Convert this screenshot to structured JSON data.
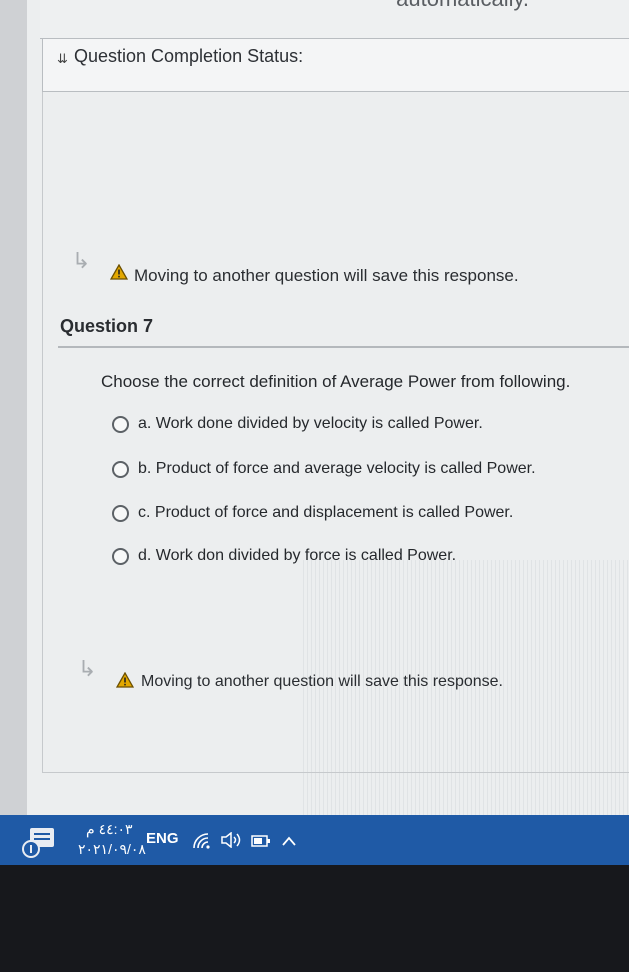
{
  "page": {
    "top_fragment": "automatically.",
    "status_toggle_icon": "chevron-double-down-icon",
    "status_label": "Question Completion Status:"
  },
  "warnings": [
    {
      "icon": "return-arrow-icon",
      "warn_icon": "warning-triangle-icon",
      "text": "Moving to another question will save this response."
    },
    {
      "icon": "return-arrow-icon",
      "warn_icon": "warning-triangle-icon",
      "text": "Moving to another question will save this response."
    }
  ],
  "question": {
    "title": "Question 7",
    "text": "Choose the correct definition of Average Power from following.",
    "options": [
      {
        "label": "a. Work done divided by velocity is called Power.",
        "selected": false
      },
      {
        "label": "b. Product of force and average velocity is called Power.",
        "selected": false
      },
      {
        "label": "c. Product of force and displacement is called Power.",
        "selected": false
      },
      {
        "label": "d. Work don divided by force is called Power.",
        "selected": false
      }
    ]
  },
  "taskbar": {
    "time": "٤٤:٠٣ م",
    "date": "٢٠٢١/٠٩/٠٨",
    "language": "ENG",
    "tray_icons": [
      "wifi-icon",
      "volume-icon",
      "battery-icon",
      "chevron-up-icon"
    ],
    "notification_icon": "notification-center-icon"
  },
  "colors": {
    "taskbar": "#1f5aa6",
    "page": "#eceeef",
    "warning": "#d9a400"
  }
}
